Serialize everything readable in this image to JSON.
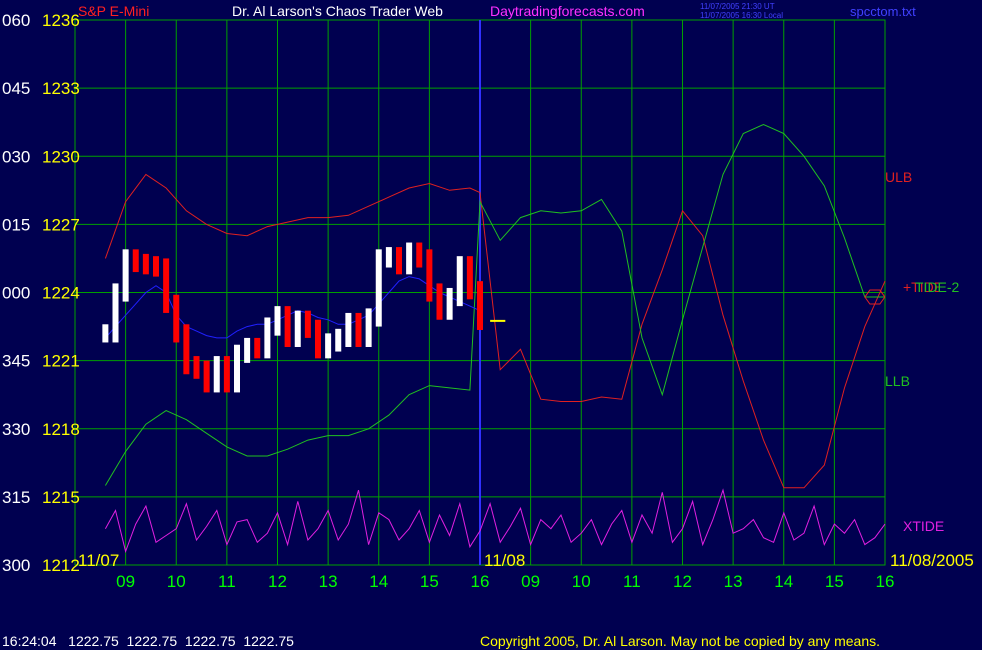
{
  "header": {
    "symbol": "S&P E-Mini",
    "title_left": "Dr. Al Larson's Chaos Trader Web",
    "title_site": "Daytradingforecasts.com",
    "stamp_line1": "11/07/2005 21:30 UT",
    "stamp_line2": "11/07/2005 16:30 Local",
    "filename": "spcctom.txt"
  },
  "footer": {
    "quote": "16:24:04   1222.75  1222.75  1222.75  1222.75",
    "copyright": "Copyright 2005, Dr. Al Larson. May not be copied by any means."
  },
  "colors": {
    "background": "#000050",
    "grid": "#00a000",
    "price_up": "#ffffff",
    "price_down": "#ff0000",
    "ulb": "#e02020",
    "llb": "#20c020",
    "xtide": "#e020e0",
    "tide_blue": "#2020ff",
    "label_yellow": "#ffff00",
    "time_green": "#00ff00"
  },
  "chart_data": {
    "type": "line",
    "title": "S&P E-Mini",
    "y_axis": {
      "angle_labels": [
        "060",
        "045",
        "030",
        "015",
        "000",
        "345",
        "330",
        "315",
        "300"
      ],
      "price_labels": [
        "1236",
        "1233",
        "1230",
        "1227",
        "1224",
        "1221",
        "1218",
        "1215",
        "1212"
      ],
      "ylim": [
        1212,
        1236
      ]
    },
    "x_axis": {
      "date_labels": [
        "11/07",
        "11/08",
        "11/08/2005"
      ],
      "hour_labels": [
        "09",
        "10",
        "11",
        "12",
        "13",
        "14",
        "15",
        "16",
        "09",
        "10",
        "11",
        "12",
        "13",
        "14",
        "15",
        "16"
      ]
    },
    "grid": true,
    "series_labels": {
      "ulb": "ULB",
      "llb": "LLB",
      "tide": "TIDE-2",
      "tide_alt": "+TIDE",
      "xtide": "XTIDE"
    },
    "series": [
      {
        "name": "Price",
        "x": [
          8.6,
          8.8,
          9.0,
          9.2,
          9.4,
          9.6,
          9.8,
          10.0,
          10.2,
          10.4,
          10.6,
          10.8,
          11.0,
          11.2,
          11.4,
          11.6,
          11.8,
          12.0,
          12.2,
          12.4,
          12.6,
          12.8,
          13.0,
          13.2,
          13.4,
          13.6,
          13.8,
          14.0,
          14.2,
          14.4,
          14.6,
          14.8,
          15.0,
          15.2,
          15.4,
          15.6,
          15.8,
          16.0
        ],
        "y": [
          1222.2,
          1224.0,
          1225.5,
          1225.3,
          1225.2,
          1225.1,
          1223.5,
          1222.2,
          1220.8,
          1220.6,
          1220.0,
          1220.8,
          1220.0,
          1221.3,
          1221.6,
          1221.5,
          1222.5,
          1223.0,
          1222.0,
          1222.8,
          1222.4,
          1221.5,
          1221.8,
          1222.0,
          1222.7,
          1222.0,
          1222.9,
          1225.5,
          1225.6,
          1225.2,
          1225.8,
          1225.5,
          1224.0,
          1223.2,
          1223.8,
          1225.2,
          1224.1,
          1222.75
        ]
      },
      {
        "name": "ULB",
        "x": [
          8.6,
          9.0,
          9.4,
          9.8,
          10.2,
          10.6,
          11.0,
          11.4,
          11.8,
          12.2,
          12.6,
          13.0,
          13.4,
          13.8,
          14.2,
          14.6,
          15.0,
          15.4,
          15.8,
          16.0,
          16.4,
          16.8,
          17.2,
          17.6,
          18.0,
          18.4,
          18.8,
          19.2,
          19.6,
          20.0,
          20.4,
          20.8,
          21.2,
          21.6,
          22.0,
          22.4,
          22.8,
          23.2,
          23.6,
          24.0
        ],
        "y": [
          1225.5,
          1228.0,
          1229.2,
          1228.6,
          1227.6,
          1227.0,
          1226.6,
          1226.5,
          1226.9,
          1227.1,
          1227.3,
          1227.3,
          1227.4,
          1227.8,
          1228.2,
          1228.6,
          1228.8,
          1228.5,
          1228.6,
          1228.4,
          1220.6,
          1221.5,
          1219.3,
          1219.2,
          1219.2,
          1219.4,
          1219.3,
          1222.6,
          1225.0,
          1227.6,
          1226.5,
          1223.0,
          1220.1,
          1217.5,
          1215.4,
          1215.4,
          1216.4,
          1219.8,
          1222.5,
          1224.5
        ]
      },
      {
        "name": "LLB",
        "x": [
          8.6,
          9.0,
          9.4,
          9.8,
          10.2,
          10.6,
          11.0,
          11.4,
          11.8,
          12.2,
          12.6,
          13.0,
          13.4,
          13.8,
          14.2,
          14.6,
          15.0,
          15.4,
          15.8,
          16.0,
          16.4,
          16.8,
          17.2,
          17.6,
          18.0,
          18.4,
          18.8,
          19.2,
          19.6,
          20.0,
          20.4,
          20.8,
          21.2,
          21.6,
          22.0,
          22.4,
          22.8,
          23.2,
          23.6,
          24.0
        ],
        "y": [
          1215.5,
          1217.0,
          1218.2,
          1218.8,
          1218.4,
          1217.8,
          1217.2,
          1216.8,
          1216.8,
          1217.1,
          1217.5,
          1217.7,
          1217.7,
          1218.0,
          1218.6,
          1219.5,
          1219.9,
          1219.8,
          1219.7,
          1228.0,
          1226.3,
          1227.3,
          1227.6,
          1227.5,
          1227.6,
          1228.1,
          1226.7,
          1222.0,
          1219.5,
          1222.8,
          1226.0,
          1229.2,
          1231.0,
          1231.4,
          1231.0,
          1230.0,
          1228.7,
          1226.4,
          1223.8,
          1223.8
        ]
      },
      {
        "name": "TIDE-2",
        "x": [
          8.6,
          8.8,
          9.0,
          9.2,
          9.4,
          9.6,
          9.8,
          10.0,
          10.2,
          10.4,
          10.6,
          10.8,
          11.0,
          11.2,
          11.4,
          11.6,
          11.8,
          12.0,
          12.2,
          12.4,
          12.6,
          12.8,
          13.0,
          13.2,
          13.4,
          13.6,
          13.8,
          14.0,
          14.2,
          14.4,
          14.6,
          14.8,
          15.0,
          15.2,
          15.4,
          15.6,
          15.8,
          16.0
        ],
        "y": [
          1222.0,
          1222.5,
          1223.0,
          1223.5,
          1224.0,
          1224.3,
          1224.0,
          1223.0,
          1222.5,
          1222.3,
          1222.1,
          1222.0,
          1222.0,
          1222.3,
          1222.5,
          1222.6,
          1222.6,
          1222.8,
          1223.0,
          1223.2,
          1223.1,
          1222.9,
          1222.8,
          1222.6,
          1222.6,
          1222.8,
          1223.0,
          1223.5,
          1224.0,
          1224.5,
          1224.7,
          1224.6,
          1224.3,
          1224.0,
          1223.8,
          1223.6,
          1223.4,
          1223.2
        ]
      },
      {
        "name": "XTIDE",
        "x": [
          8.6,
          8.8,
          9.0,
          9.2,
          9.4,
          9.6,
          9.8,
          10.0,
          10.2,
          10.4,
          10.6,
          10.8,
          11.0,
          11.2,
          11.4,
          11.6,
          11.8,
          12.0,
          12.2,
          12.4,
          12.6,
          12.8,
          13.0,
          13.2,
          13.4,
          13.6,
          13.8,
          14.0,
          14.2,
          14.4,
          14.6,
          14.8,
          15.0,
          15.2,
          15.4,
          15.6,
          15.8,
          16.0,
          16.2,
          16.4,
          16.6,
          16.8,
          17.0,
          17.2,
          17.4,
          17.6,
          17.8,
          18.0,
          18.2,
          18.4,
          18.6,
          18.8,
          19.0,
          19.2,
          19.4,
          19.6,
          19.8,
          20.0,
          20.2,
          20.4,
          20.6,
          20.8,
          21.0,
          21.2,
          21.4,
          21.6,
          21.8,
          22.0,
          22.2,
          22.4,
          22.6,
          22.8,
          23.0,
          23.2,
          23.4,
          23.6,
          23.8,
          24.0
        ],
        "y": [
          1213.6,
          1214.4,
          1212.6,
          1213.8,
          1214.6,
          1213.0,
          1213.3,
          1213.6,
          1214.7,
          1213.1,
          1213.7,
          1214.4,
          1212.9,
          1213.9,
          1214.0,
          1213.0,
          1213.4,
          1214.3,
          1212.9,
          1214.8,
          1213.1,
          1213.6,
          1214.4,
          1213.1,
          1213.8,
          1215.3,
          1212.9,
          1214.3,
          1214.0,
          1213.1,
          1213.6,
          1214.4,
          1213.0,
          1214.2,
          1213.3,
          1214.7,
          1212.8,
          1213.5,
          1214.7,
          1213.0,
          1213.7,
          1214.5,
          1212.9,
          1214.0,
          1213.6,
          1214.2,
          1213.0,
          1213.4,
          1214.0,
          1212.9,
          1213.8,
          1214.4,
          1213.0,
          1214.2,
          1213.4,
          1215.2,
          1213.0,
          1213.6,
          1214.8,
          1212.9,
          1214.0,
          1215.3,
          1213.4,
          1213.6,
          1214.0,
          1213.2,
          1213.0,
          1214.3,
          1213.1,
          1213.4,
          1214.6,
          1212.9,
          1213.8,
          1213.4,
          1214.0,
          1212.9,
          1213.2,
          1213.8
        ]
      }
    ]
  }
}
